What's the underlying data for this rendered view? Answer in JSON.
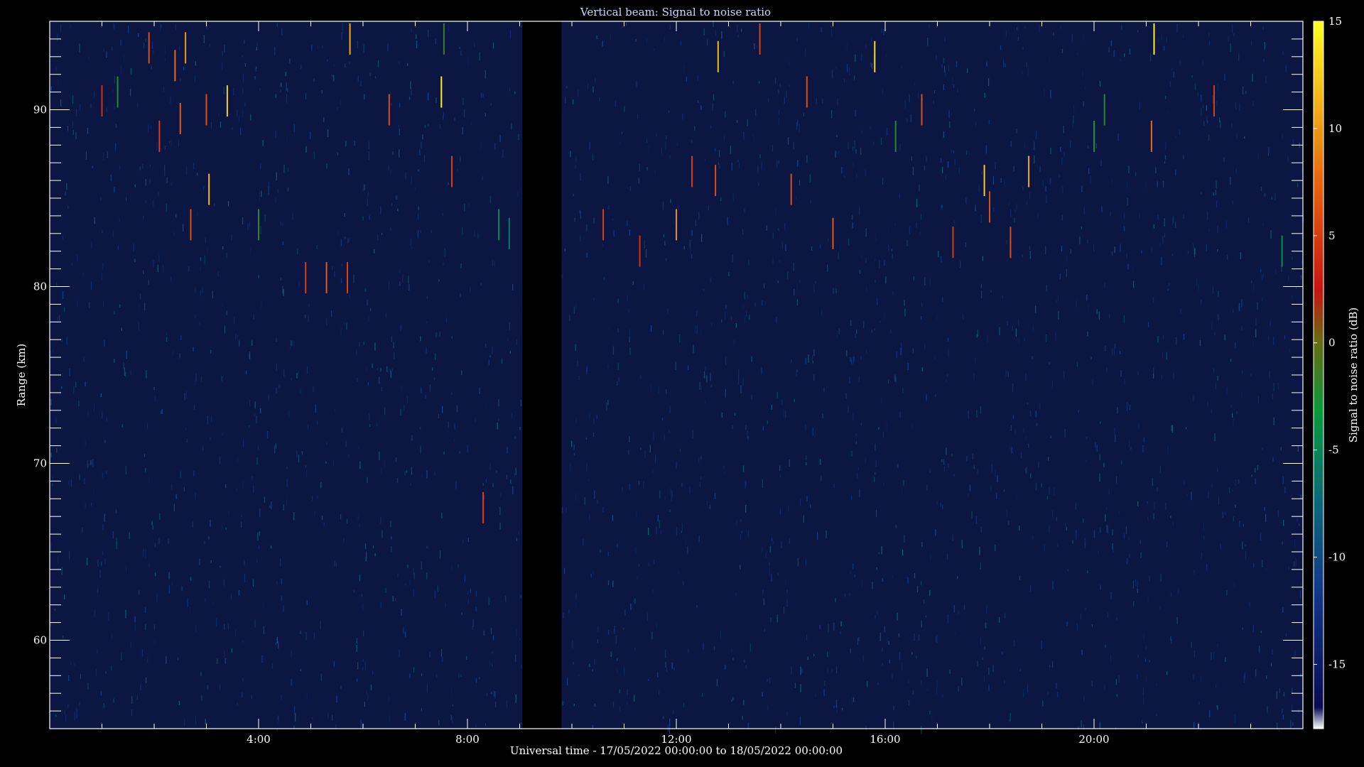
{
  "chart_data": {
    "type": "heatmap",
    "title": "Vertical beam: Signal to noise ratio",
    "xlabel": "Universal time - 17/05/2022 00:00:00 to 18/05/2022 00:00:00",
    "ylabel": "Range (km)",
    "colorbar_label": "Signal to noise ratio (dB)",
    "x_unit": "hours UT",
    "xlim": [
      0,
      24
    ],
    "ylim": [
      55,
      95
    ],
    "clim": [
      -18,
      15
    ],
    "x_ticks": [
      {
        "value": 4,
        "label": "4:00"
      },
      {
        "value": 8,
        "label": "8:00"
      },
      {
        "value": 12,
        "label": "12:00"
      },
      {
        "value": 16,
        "label": "16:00"
      },
      {
        "value": 20,
        "label": "20:00"
      }
    ],
    "y_ticks": [
      {
        "value": 60,
        "label": "60"
      },
      {
        "value": 70,
        "label": "70"
      },
      {
        "value": 80,
        "label": "80"
      },
      {
        "value": 90,
        "label": "90"
      }
    ],
    "colorbar_ticks": [
      {
        "value": -15,
        "label": "-15"
      },
      {
        "value": -10,
        "label": "-10"
      },
      {
        "value": -5,
        "label": "-5"
      },
      {
        "value": 0,
        "label": "0"
      },
      {
        "value": 5,
        "label": "5"
      },
      {
        "value": 10,
        "label": "10"
      },
      {
        "value": 15,
        "label": "15"
      }
    ],
    "background_snr_db": -16,
    "data_gap": [
      9.05,
      9.8
    ],
    "events": [
      {
        "t": 1.0,
        "range": 90.5,
        "snr": 2
      },
      {
        "t": 1.3,
        "range": 91.0,
        "snr": -5
      },
      {
        "t": 1.9,
        "range": 93.5,
        "snr": 4
      },
      {
        "t": 2.1,
        "range": 88.5,
        "snr": 3
      },
      {
        "t": 2.4,
        "range": 92.5,
        "snr": 6
      },
      {
        "t": 2.5,
        "range": 89.5,
        "snr": 5
      },
      {
        "t": 2.6,
        "range": 93.5,
        "snr": 9
      },
      {
        "t": 2.7,
        "range": 83.5,
        "snr": 4
      },
      {
        "t": 3.0,
        "range": 90.0,
        "snr": 4
      },
      {
        "t": 3.05,
        "range": 85.5,
        "snr": 11
      },
      {
        "t": 3.4,
        "range": 90.5,
        "snr": 12
      },
      {
        "t": 4.0,
        "range": 83.5,
        "snr": -5
      },
      {
        "t": 4.9,
        "range": 80.5,
        "snr": 3
      },
      {
        "t": 5.3,
        "range": 80.5,
        "snr": 5
      },
      {
        "t": 5.7,
        "range": 80.5,
        "snr": 3
      },
      {
        "t": 5.75,
        "range": 94.0,
        "snr": 10
      },
      {
        "t": 6.5,
        "range": 90.0,
        "snr": 4
      },
      {
        "t": 7.5,
        "range": 91.0,
        "snr": 14
      },
      {
        "t": 7.55,
        "range": 94.0,
        "snr": -4
      },
      {
        "t": 7.7,
        "range": 86.5,
        "snr": 3
      },
      {
        "t": 8.3,
        "range": 67.5,
        "snr": 3
      },
      {
        "t": 8.6,
        "range": 83.5,
        "snr": -8
      },
      {
        "t": 8.8,
        "range": 83.0,
        "snr": -9
      },
      {
        "t": 10.6,
        "range": 83.5,
        "snr": 3
      },
      {
        "t": 11.3,
        "range": 82.0,
        "snr": 2
      },
      {
        "t": 12.0,
        "range": 83.5,
        "snr": 8
      },
      {
        "t": 12.3,
        "range": 86.5,
        "snr": 3
      },
      {
        "t": 12.75,
        "range": 86.0,
        "snr": 4
      },
      {
        "t": 12.8,
        "range": 93.0,
        "snr": 11
      },
      {
        "t": 13.6,
        "range": 94.0,
        "snr": 3
      },
      {
        "t": 14.2,
        "range": 85.5,
        "snr": 4
      },
      {
        "t": 14.5,
        "range": 91.0,
        "snr": 4
      },
      {
        "t": 15.0,
        "range": 83.0,
        "snr": 5
      },
      {
        "t": 15.8,
        "range": 93.0,
        "snr": 13
      },
      {
        "t": 16.2,
        "range": 88.5,
        "snr": -5
      },
      {
        "t": 16.7,
        "range": 90.0,
        "snr": 4
      },
      {
        "t": 17.3,
        "range": 82.5,
        "snr": 3
      },
      {
        "t": 17.9,
        "range": 86.0,
        "snr": 12
      },
      {
        "t": 18.0,
        "range": 84.5,
        "snr": 4
      },
      {
        "t": 18.4,
        "range": 82.5,
        "snr": 4
      },
      {
        "t": 18.75,
        "range": 86.5,
        "snr": 10
      },
      {
        "t": 20.0,
        "range": 88.5,
        "snr": -6
      },
      {
        "t": 20.2,
        "range": 90.0,
        "snr": -5
      },
      {
        "t": 21.1,
        "range": 88.5,
        "snr": 6
      },
      {
        "t": 21.15,
        "range": 94.0,
        "snr": 14
      },
      {
        "t": 22.3,
        "range": 90.5,
        "snr": 3
      },
      {
        "t": 23.6,
        "range": 82.0,
        "snr": -7
      }
    ]
  }
}
